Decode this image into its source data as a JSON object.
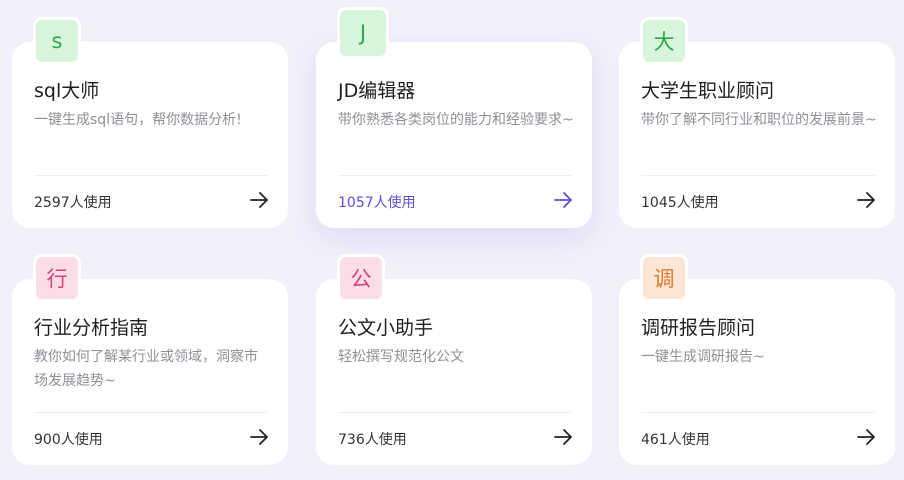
{
  "cards": [
    {
      "icon_char": "s",
      "icon_color": "#2aa84a",
      "icon_bg": "#d8f5dc",
      "title": "sql大师",
      "desc": "一键生成sql语句，帮你数据分析!",
      "usage": "2597人使用",
      "hovered": false
    },
    {
      "icon_char": "J",
      "icon_color": "#2aa84a",
      "icon_bg": "#d8f5dc",
      "title": "JD编辑器",
      "desc": "带你熟悉各类岗位的能力和经验要求~",
      "usage": "1057人使用",
      "hovered": true
    },
    {
      "icon_char": "大",
      "icon_color": "#2aa84a",
      "icon_bg": "#d8f5dc",
      "title": "大学生职业顾问",
      "desc": "带你了解不同行业和职位的发展前景~",
      "usage": "1045人使用",
      "hovered": false
    },
    {
      "icon_char": "行",
      "icon_color": "#d9417a",
      "icon_bg": "#fbdde8",
      "title": "行业分析指南",
      "desc": "教你如何了解某行业或领域，洞察市场发展趋势~",
      "usage": "900人使用",
      "hovered": false
    },
    {
      "icon_char": "公",
      "icon_color": "#d9417a",
      "icon_bg": "#fbdde8",
      "title": "公文小助手",
      "desc": "轻松撰写规范化公文",
      "usage": "736人使用",
      "hovered": false
    },
    {
      "icon_char": "调",
      "icon_color": "#e07a32",
      "icon_bg": "#fde6d3",
      "title": "调研报告顾问",
      "desc": "一键生成调研报告~",
      "usage": "461人使用",
      "hovered": false
    }
  ],
  "colors": {
    "page_bg": "#f1f0fb",
    "accent": "#5b4fd6",
    "arrow_default": "#222222"
  }
}
